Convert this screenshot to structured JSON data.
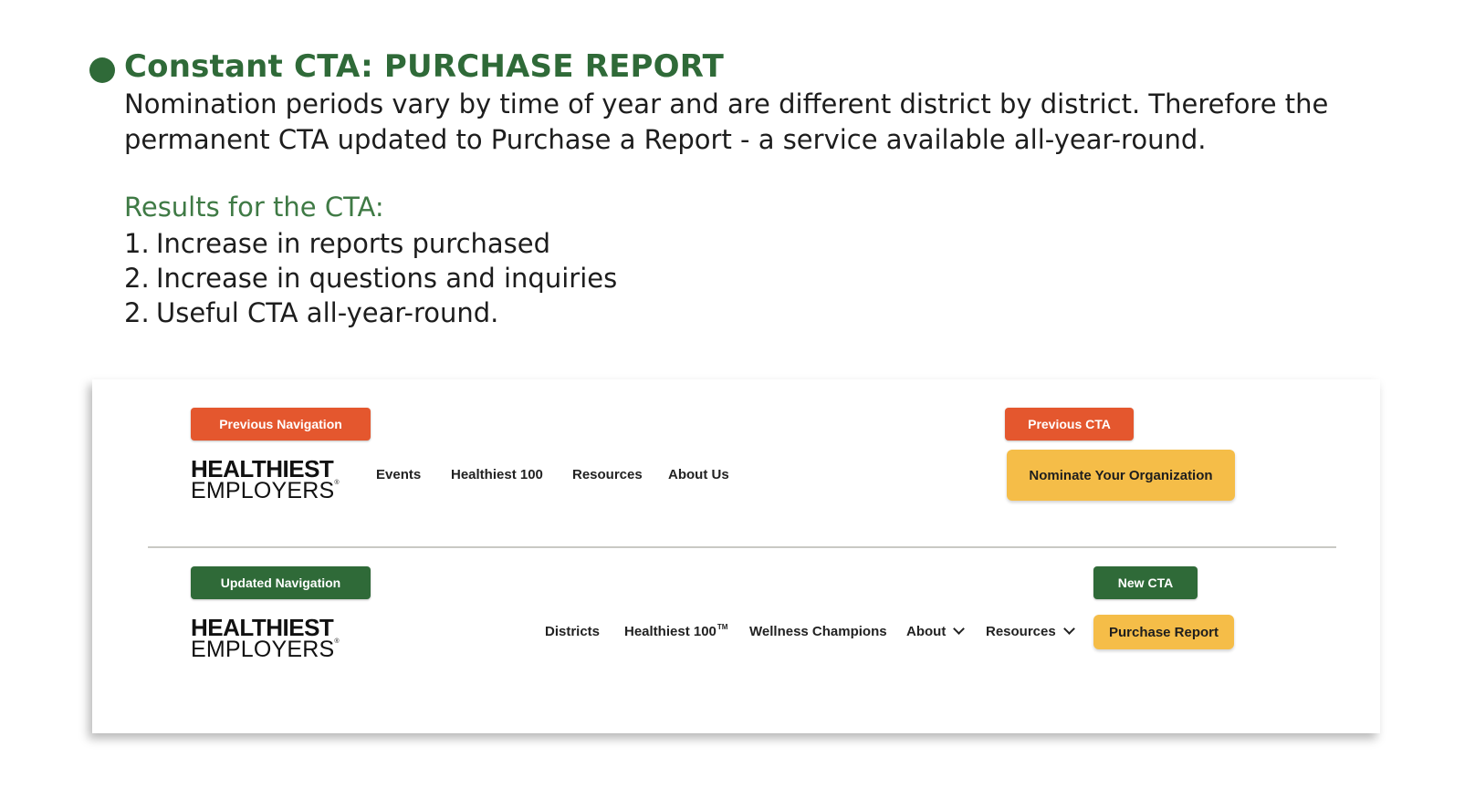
{
  "section": {
    "title": "Constant CTA: PURCHASE REPORT",
    "description": "Nomination periods vary by time of year and are different district by district. Therefore the permanent CTA updated to Purchase a Report - a service available all-year-round.",
    "results_label": "Results for the CTA:",
    "results": [
      {
        "num": "1.",
        "text": "Increase in reports purchased"
      },
      {
        "num": "2.",
        "text": "Increase in questions and inquiries"
      },
      {
        "num": "2.",
        "text": "Useful CTA all-year-round."
      }
    ]
  },
  "colors": {
    "accent_green": "#2f6a38",
    "label_orange": "#e4572e",
    "cta_yellow": "#f5bd48"
  },
  "screenshot": {
    "previous": {
      "nav_tag": "Previous Navigation",
      "cta_tag": "Previous CTA",
      "logo_line1": "HEALTHIEST",
      "logo_line2": "EMPLOYERS",
      "logo_mark": "®",
      "nav": [
        "Events",
        "Healthiest 100",
        "Resources",
        "About Us"
      ],
      "cta_button": "Nominate Your Organization"
    },
    "updated": {
      "nav_tag": "Updated Navigation",
      "cta_tag": "New CTA",
      "logo_line1": "HEALTHIEST",
      "logo_line2": "EMPLOYERS",
      "logo_mark": "®",
      "nav": {
        "districts": "Districts",
        "healthiest100": "Healthiest 100",
        "healthiest100_mark": "TM",
        "wellness": "Wellness Champions",
        "about": "About",
        "resources": "Resources"
      },
      "cta_button": "Purchase Report"
    }
  }
}
